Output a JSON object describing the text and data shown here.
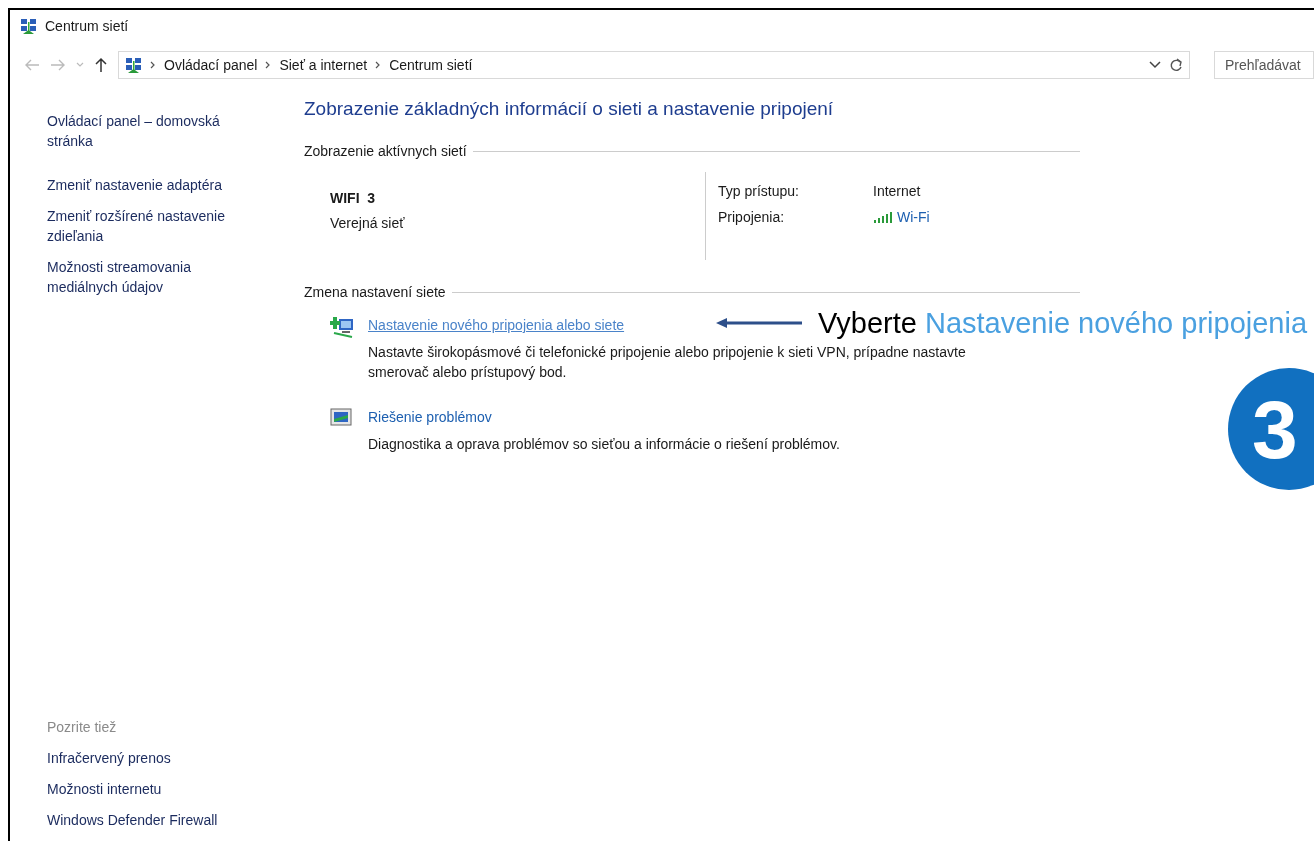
{
  "window": {
    "title": "Centrum sietí"
  },
  "address_bar": {
    "crumbs": [
      "Ovládací panel",
      "Sieť a internet",
      "Centrum sietí"
    ]
  },
  "search": {
    "placeholder": "Prehľadávat"
  },
  "sidebar": {
    "links": [
      "Ovládací panel – domovská stránka",
      "Zmeniť nastavenie adaptéra",
      "Zmeniť rozšírené nastavenie zdieľania",
      "Možnosti streamovania mediálnych údajov"
    ],
    "see_also": {
      "heading": "Pozrite tiež",
      "links": [
        "Infračervený prenos",
        "Možnosti internetu",
        "Windows Defender Firewall"
      ]
    }
  },
  "main": {
    "heading": "Zobrazenie základných informácií o sieti a nastavenie pripojení",
    "active_networks": {
      "heading": "Zobrazenie aktívnych sietí",
      "name": "WIFI  3",
      "type": "Verejná sieť",
      "properties": [
        {
          "label": "Typ prístupu:",
          "value": "Internet",
          "kind": "text"
        },
        {
          "label": "Pripojenia:",
          "value": "Wi-Fi",
          "kind": "link"
        }
      ]
    },
    "change_settings": {
      "heading": "Zmena nastavení siete",
      "tasks": [
        {
          "kind": "new-connection",
          "title": "Nastavenie nového pripojenia alebo siete",
          "underlined": true,
          "description": "Nastavte širokopásmové či telefonické pripojenie alebo pripojenie k sieti VPN, prípadne nastavte smerovač alebo prístupový bod."
        },
        {
          "kind": "troubleshoot",
          "title": "Riešenie problémov",
          "underlined": false,
          "description": "Diagnostika a oprava problémov so sieťou a informácie o riešení problémov."
        }
      ]
    }
  },
  "callout": {
    "label": "Vyberte",
    "target": "Nastavenie nového pripojenia",
    "step": "3"
  }
}
